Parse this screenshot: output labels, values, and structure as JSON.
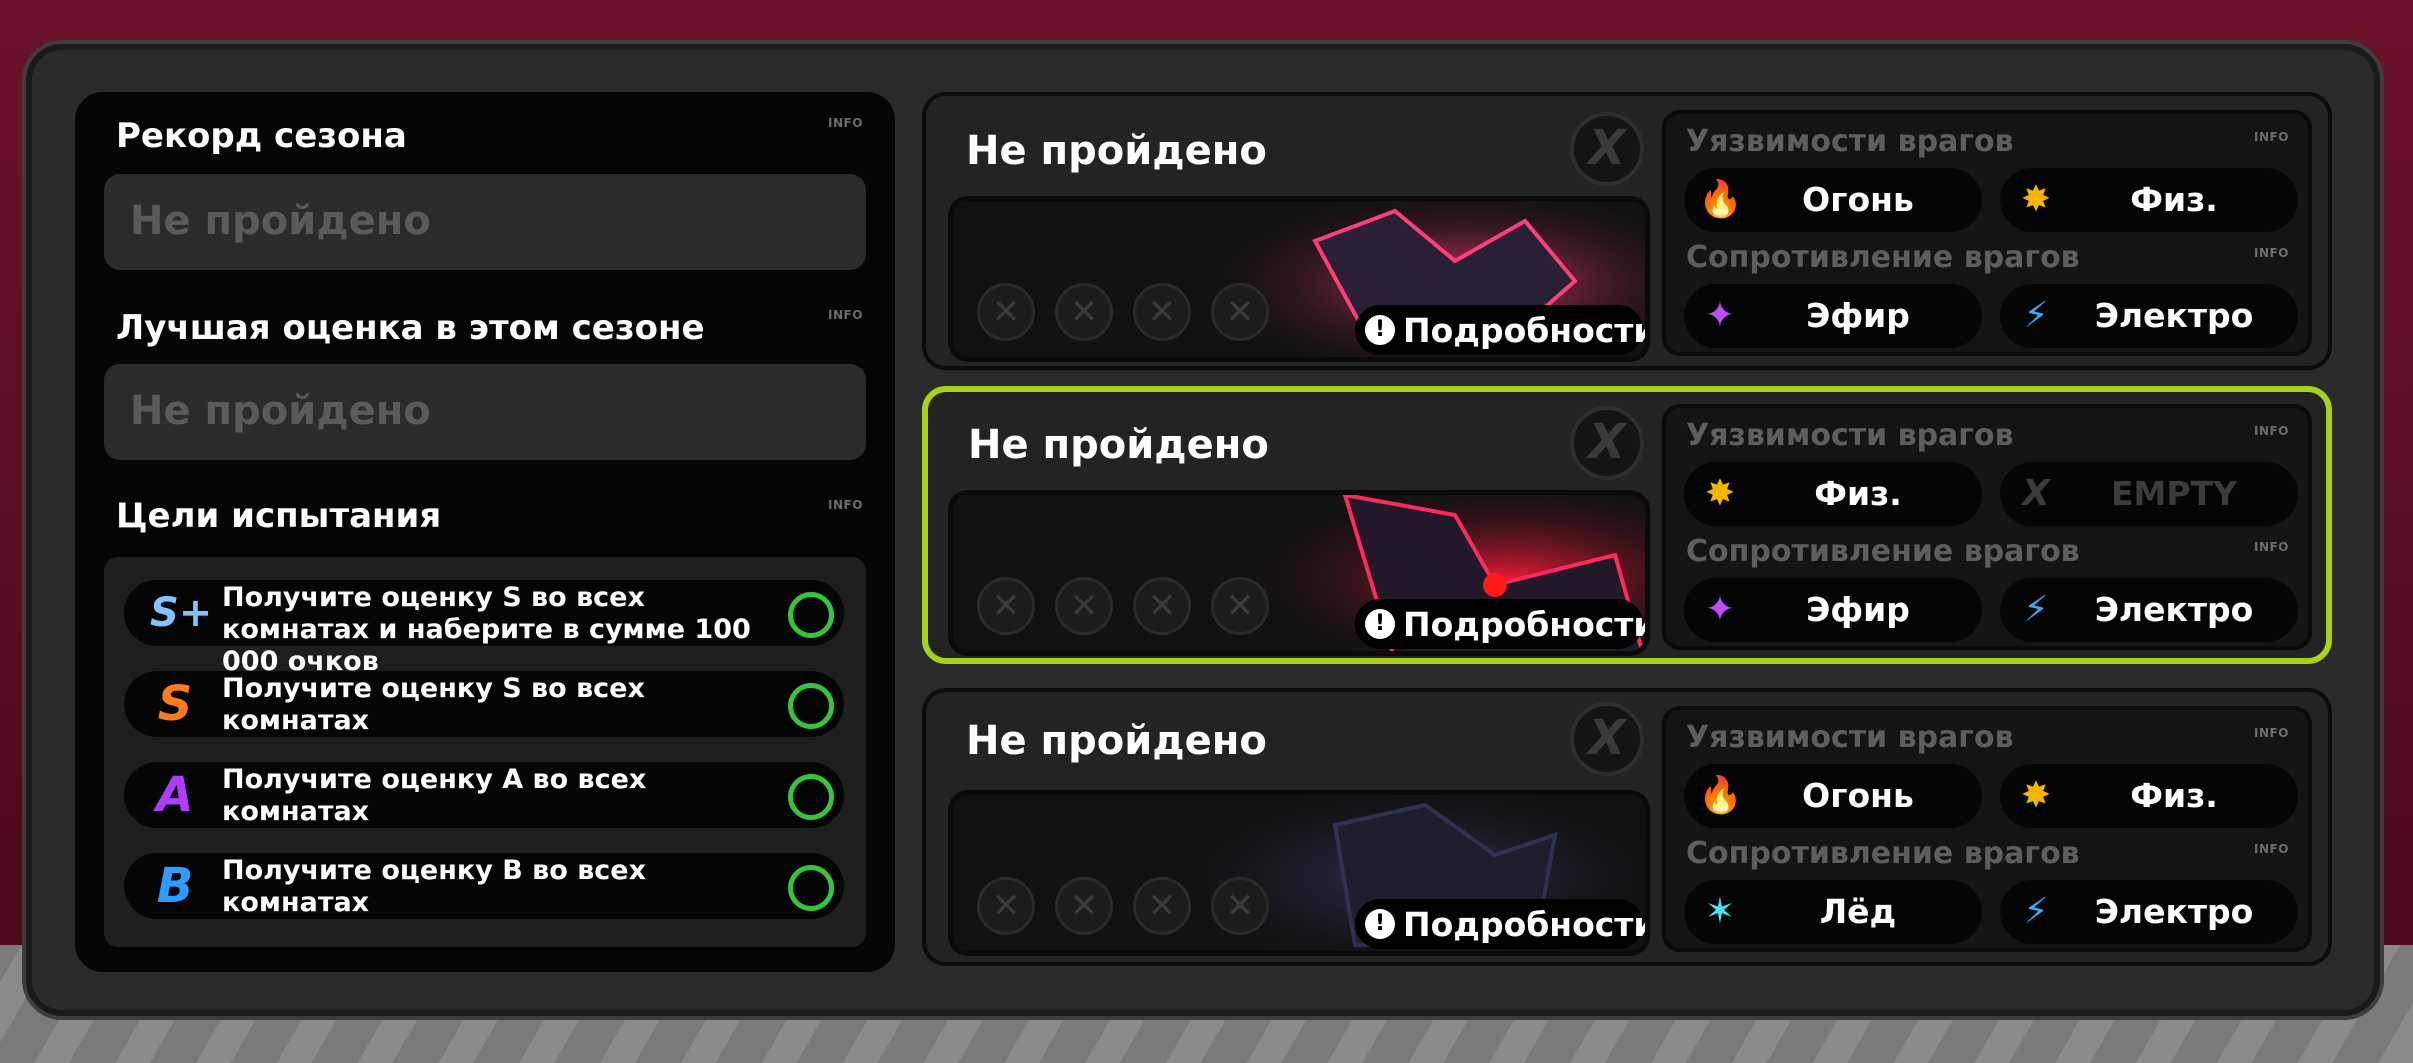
{
  "left": {
    "info": "INFO",
    "record_title": "Рекорд сезона",
    "record_value": "Не пройдено",
    "best_title": "Лучшая оценка в этом сезоне",
    "best_value": "Не пройдено",
    "goals_title": "Цели испытания",
    "goals": [
      {
        "badge": "S+",
        "badge_color": "#7fc4ff",
        "text": "Получите оценку S во всех комнатах и наберите в сумме 100 000 очков"
      },
      {
        "badge": "S",
        "badge_color": "#ff7a1a",
        "text": "Получите оценку S во всех комнатах"
      },
      {
        "badge": "A",
        "badge_color": "#b03cff",
        "text": "Получите оценку A во всех комнатах"
      },
      {
        "badge": "B",
        "badge_color": "#2f9bff",
        "text": "Получите оценку B во всех комнатах"
      }
    ],
    "goal_done_color": "#36c53a"
  },
  "rooms": [
    {
      "title": "Не пройдено",
      "close": "X",
      "details": "Подробности",
      "details_icon": "!",
      "weak_label": "Уязвимости врагов",
      "resist_label": "Сопротивление врагов",
      "info": "INFO",
      "weak": [
        {
          "icon": "fire-icon",
          "glyph": "🔥",
          "label": "Огонь"
        },
        {
          "icon": "physical-icon",
          "glyph": "✸",
          "label": "Физ."
        }
      ],
      "resist": [
        {
          "icon": "ether-icon",
          "glyph": "✦",
          "label": "Эфир"
        },
        {
          "icon": "electric-icon",
          "glyph": "⚡",
          "label": "Электро"
        }
      ]
    },
    {
      "title": "Не пройдено",
      "close": "X",
      "details": "Подробности",
      "details_icon": "!",
      "weak_label": "Уязвимости врагов",
      "resist_label": "Сопротивление врагов",
      "info": "INFO",
      "weak": [
        {
          "icon": "physical-icon",
          "glyph": "✸",
          "label": "Физ."
        },
        {
          "icon": "empty-icon",
          "glyph": "X",
          "label": "EMPTY"
        }
      ],
      "resist": [
        {
          "icon": "ether-icon",
          "glyph": "✦",
          "label": "Эфир"
        },
        {
          "icon": "electric-icon",
          "glyph": "⚡",
          "label": "Электро"
        }
      ]
    },
    {
      "title": "Не пройдено",
      "close": "X",
      "details": "Подробности",
      "details_icon": "!",
      "weak_label": "Уязвимости врагов",
      "resist_label": "Сопротивление врагов",
      "info": "INFO",
      "weak": [
        {
          "icon": "fire-icon",
          "glyph": "🔥",
          "label": "Огонь"
        },
        {
          "icon": "physical-icon",
          "glyph": "✸",
          "label": "Физ."
        }
      ],
      "resist": [
        {
          "icon": "ice-icon",
          "glyph": "✶",
          "label": "Лёд"
        },
        {
          "icon": "electric-icon",
          "glyph": "⚡",
          "label": "Электро"
        }
      ]
    }
  ],
  "colors": {
    "selected_border": "#a8d11a",
    "fire": "#ff4a1a",
    "physical": "#f5b400",
    "ether": "#c04dff",
    "electric": "#3aa8ff",
    "ice": "#49e0f0"
  }
}
